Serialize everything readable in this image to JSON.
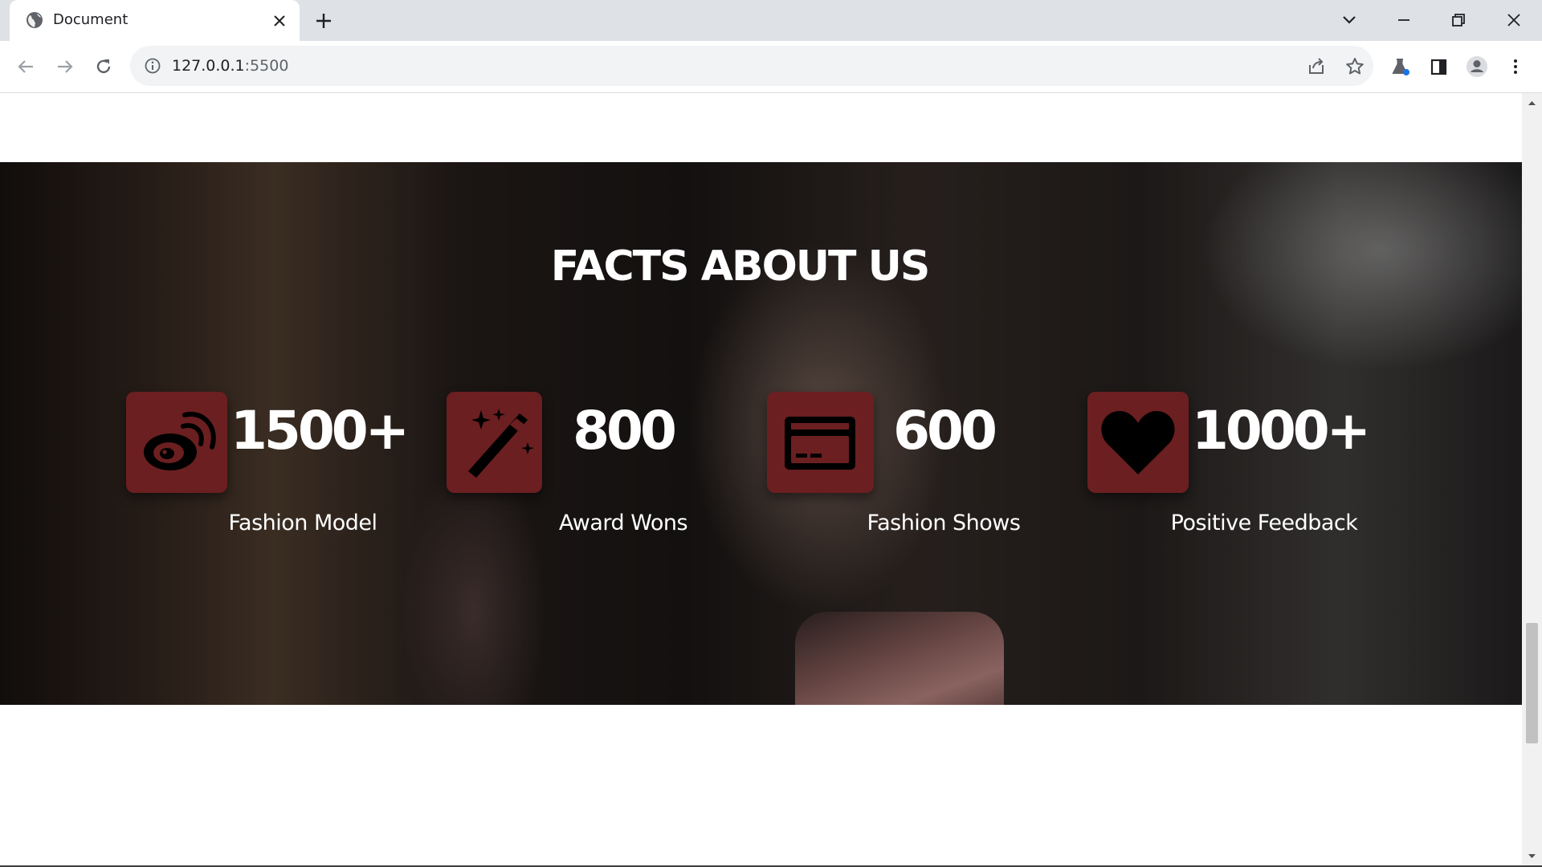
{
  "browser": {
    "tab_title": "Document",
    "url_host": "127.0.0.1",
    "url_port": ":5500"
  },
  "facts": {
    "title": "FACTS ABOUT US",
    "items": [
      {
        "number": "1500+",
        "label": "Fashion Model",
        "icon": "weibo-icon"
      },
      {
        "number": "800",
        "label": "Award Wons",
        "icon": "magic-wand-icon"
      },
      {
        "number": "600",
        "label": "Fashion Shows",
        "icon": "credit-card-icon"
      },
      {
        "number": "1000+",
        "label": "Positive Feedback",
        "icon": "heart-icon"
      }
    ]
  },
  "colors": {
    "icon_box": "#6b1f20",
    "icon_glyph": "#000000",
    "text": "#ffffff",
    "tabstrip": "#dee1e6",
    "omnibox": "#f1f3f4"
  }
}
